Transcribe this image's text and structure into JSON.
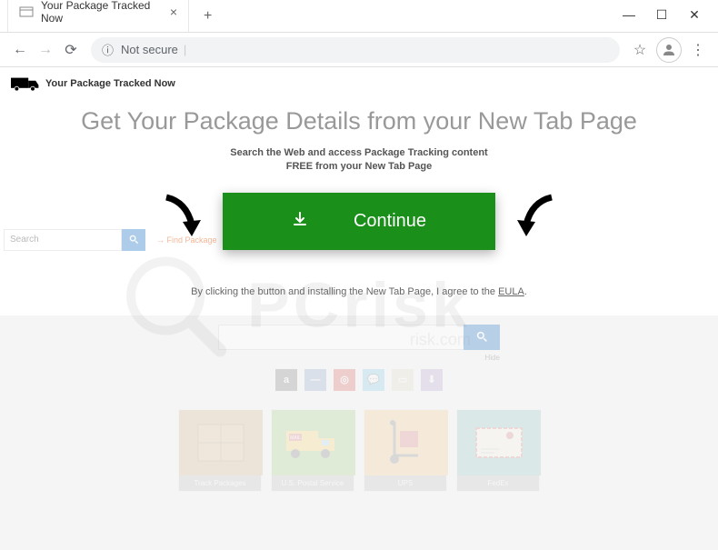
{
  "browser": {
    "tab_title": "Your Package Tracked Now",
    "address_text": "Not secure"
  },
  "header": {
    "brand": "Your Package Tracked Now"
  },
  "main": {
    "heading": "Get Your Package Details from your New Tab Page",
    "subheading_line1": "Search the Web and access Package Tracking content",
    "subheading_line2": "FREE from your New Tab Page",
    "continue_label": "Continue",
    "disclaimer_prefix": "By clicking the button and installing the New Tab Page, I agree to the ",
    "disclaimer_link": "EULA",
    "disclaimer_suffix": "."
  },
  "faded": {
    "search_placeholder": "Search",
    "find_package_label": "Find Package",
    "hide_label": "Hide"
  },
  "cards": [
    {
      "label": "Track Packages"
    },
    {
      "label": "U.S. Postal Service"
    },
    {
      "label": "UPS"
    },
    {
      "label": "FedEx"
    }
  ],
  "watermark": {
    "main": "PCrisk",
    "sub": "risk.com"
  }
}
